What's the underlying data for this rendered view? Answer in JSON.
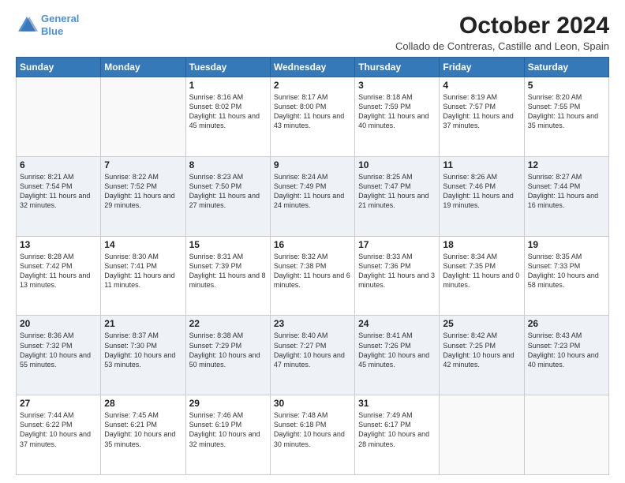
{
  "header": {
    "logo_line1": "General",
    "logo_line2": "Blue",
    "month_year": "October 2024",
    "location": "Collado de Contreras, Castille and Leon, Spain"
  },
  "days_of_week": [
    "Sunday",
    "Monday",
    "Tuesday",
    "Wednesday",
    "Thursday",
    "Friday",
    "Saturday"
  ],
  "weeks": [
    [
      {
        "day": "",
        "info": ""
      },
      {
        "day": "",
        "info": ""
      },
      {
        "day": "1",
        "info": "Sunrise: 8:16 AM\nSunset: 8:02 PM\nDaylight: 11 hours and 45 minutes."
      },
      {
        "day": "2",
        "info": "Sunrise: 8:17 AM\nSunset: 8:00 PM\nDaylight: 11 hours and 43 minutes."
      },
      {
        "day": "3",
        "info": "Sunrise: 8:18 AM\nSunset: 7:59 PM\nDaylight: 11 hours and 40 minutes."
      },
      {
        "day": "4",
        "info": "Sunrise: 8:19 AM\nSunset: 7:57 PM\nDaylight: 11 hours and 37 minutes."
      },
      {
        "day": "5",
        "info": "Sunrise: 8:20 AM\nSunset: 7:55 PM\nDaylight: 11 hours and 35 minutes."
      }
    ],
    [
      {
        "day": "6",
        "info": "Sunrise: 8:21 AM\nSunset: 7:54 PM\nDaylight: 11 hours and 32 minutes."
      },
      {
        "day": "7",
        "info": "Sunrise: 8:22 AM\nSunset: 7:52 PM\nDaylight: 11 hours and 29 minutes."
      },
      {
        "day": "8",
        "info": "Sunrise: 8:23 AM\nSunset: 7:50 PM\nDaylight: 11 hours and 27 minutes."
      },
      {
        "day": "9",
        "info": "Sunrise: 8:24 AM\nSunset: 7:49 PM\nDaylight: 11 hours and 24 minutes."
      },
      {
        "day": "10",
        "info": "Sunrise: 8:25 AM\nSunset: 7:47 PM\nDaylight: 11 hours and 21 minutes."
      },
      {
        "day": "11",
        "info": "Sunrise: 8:26 AM\nSunset: 7:46 PM\nDaylight: 11 hours and 19 minutes."
      },
      {
        "day": "12",
        "info": "Sunrise: 8:27 AM\nSunset: 7:44 PM\nDaylight: 11 hours and 16 minutes."
      }
    ],
    [
      {
        "day": "13",
        "info": "Sunrise: 8:28 AM\nSunset: 7:42 PM\nDaylight: 11 hours and 13 minutes."
      },
      {
        "day": "14",
        "info": "Sunrise: 8:30 AM\nSunset: 7:41 PM\nDaylight: 11 hours and 11 minutes."
      },
      {
        "day": "15",
        "info": "Sunrise: 8:31 AM\nSunset: 7:39 PM\nDaylight: 11 hours and 8 minutes."
      },
      {
        "day": "16",
        "info": "Sunrise: 8:32 AM\nSunset: 7:38 PM\nDaylight: 11 hours and 6 minutes."
      },
      {
        "day": "17",
        "info": "Sunrise: 8:33 AM\nSunset: 7:36 PM\nDaylight: 11 hours and 3 minutes."
      },
      {
        "day": "18",
        "info": "Sunrise: 8:34 AM\nSunset: 7:35 PM\nDaylight: 11 hours and 0 minutes."
      },
      {
        "day": "19",
        "info": "Sunrise: 8:35 AM\nSunset: 7:33 PM\nDaylight: 10 hours and 58 minutes."
      }
    ],
    [
      {
        "day": "20",
        "info": "Sunrise: 8:36 AM\nSunset: 7:32 PM\nDaylight: 10 hours and 55 minutes."
      },
      {
        "day": "21",
        "info": "Sunrise: 8:37 AM\nSunset: 7:30 PM\nDaylight: 10 hours and 53 minutes."
      },
      {
        "day": "22",
        "info": "Sunrise: 8:38 AM\nSunset: 7:29 PM\nDaylight: 10 hours and 50 minutes."
      },
      {
        "day": "23",
        "info": "Sunrise: 8:40 AM\nSunset: 7:27 PM\nDaylight: 10 hours and 47 minutes."
      },
      {
        "day": "24",
        "info": "Sunrise: 8:41 AM\nSunset: 7:26 PM\nDaylight: 10 hours and 45 minutes."
      },
      {
        "day": "25",
        "info": "Sunrise: 8:42 AM\nSunset: 7:25 PM\nDaylight: 10 hours and 42 minutes."
      },
      {
        "day": "26",
        "info": "Sunrise: 8:43 AM\nSunset: 7:23 PM\nDaylight: 10 hours and 40 minutes."
      }
    ],
    [
      {
        "day": "27",
        "info": "Sunrise: 7:44 AM\nSunset: 6:22 PM\nDaylight: 10 hours and 37 minutes."
      },
      {
        "day": "28",
        "info": "Sunrise: 7:45 AM\nSunset: 6:21 PM\nDaylight: 10 hours and 35 minutes."
      },
      {
        "day": "29",
        "info": "Sunrise: 7:46 AM\nSunset: 6:19 PM\nDaylight: 10 hours and 32 minutes."
      },
      {
        "day": "30",
        "info": "Sunrise: 7:48 AM\nSunset: 6:18 PM\nDaylight: 10 hours and 30 minutes."
      },
      {
        "day": "31",
        "info": "Sunrise: 7:49 AM\nSunset: 6:17 PM\nDaylight: 10 hours and 28 minutes."
      },
      {
        "day": "",
        "info": ""
      },
      {
        "day": "",
        "info": ""
      }
    ]
  ]
}
